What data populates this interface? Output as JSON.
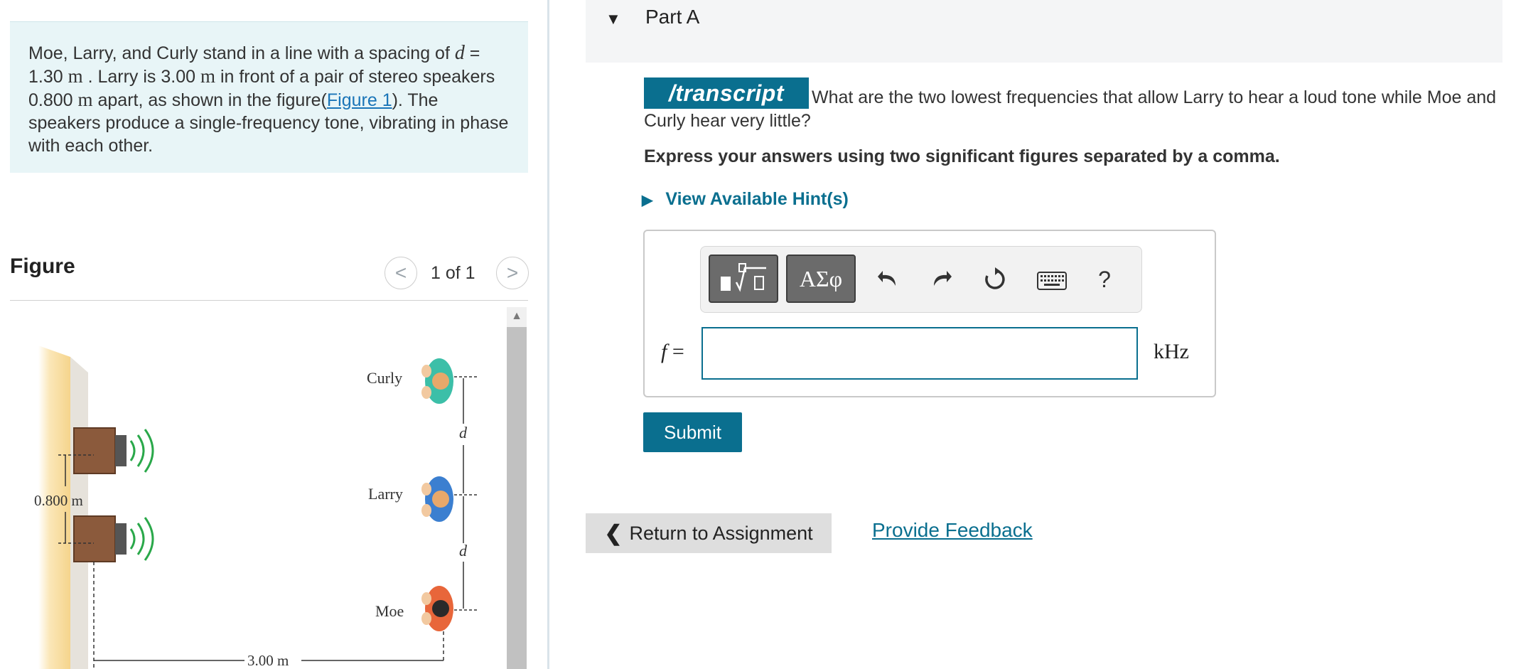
{
  "problem": {
    "part1": "Moe, Larry, and Curly stand in a line with a spacing of ",
    "var_d": "d",
    "part2": " = 1.30 ",
    "unit_m1": "m",
    "part3": " . Larry is 3.00 ",
    "unit_m2": "m",
    "part4": " in front of a pair of stereo speakers 0.800 ",
    "unit_m3": "m",
    "part5": " apart, as shown in the figure(",
    "figure_link": "Figure 1",
    "part6": "). The speakers produce a single-frequency tone, vibrating in phase with each other."
  },
  "figure": {
    "title": "Figure",
    "counter": "1 of 1",
    "prev_glyph": "<",
    "next_glyph": ">",
    "labels": {
      "curly": "Curly",
      "larry": "Larry",
      "moe": "Moe",
      "d_top": "d",
      "d_bottom": "d",
      "speaker_gap": "0.800 m",
      "distance": "3.00 m"
    }
  },
  "part_a": {
    "title": "Part A",
    "transcript_badge": "/transcript",
    "question": "What are the two lowest frequencies that allow Larry to hear a loud tone while Moe and Curly hear very little?",
    "instructions": "Express your answers using two significant figures separated by a comma.",
    "hint_label": "View Available Hint(s)",
    "toolbar": {
      "greek_label": "ΑΣφ",
      "help_label": "?"
    },
    "answer": {
      "variable": "f",
      "equals": "=",
      "value": "",
      "unit": "kHz"
    },
    "submit_label": "Submit"
  },
  "footer": {
    "return_label": "Return to Assignment",
    "feedback_label": "Provide Feedback"
  },
  "colors": {
    "accent": "#0a6f8f",
    "problem_bg": "#e8f5f7",
    "link": "#1a75b8"
  }
}
